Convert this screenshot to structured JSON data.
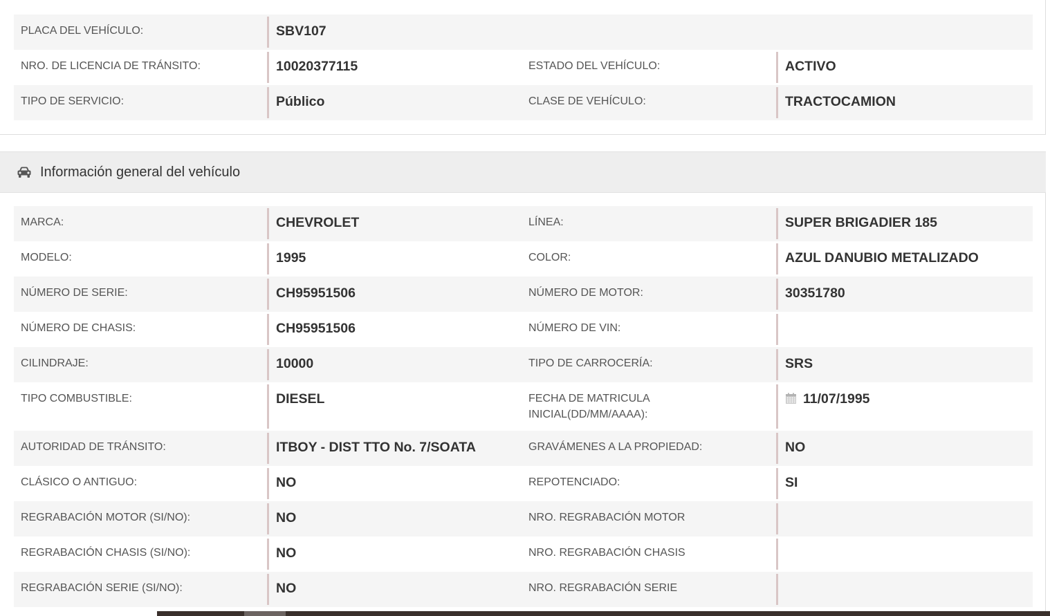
{
  "summary": {
    "rows": [
      {
        "l1": "PLACA DEL VEHÍCULO:",
        "v1": "SBV107",
        "l2": "",
        "v2": ""
      },
      {
        "l1": "NRO. DE LICENCIA DE TRÁNSITO:",
        "v1": "10020377115",
        "l2": "ESTADO DEL VEHÍCULO:",
        "v2": "ACTIVO"
      },
      {
        "l1": "TIPO DE SERVICIO:",
        "v1": "Público",
        "l2": "CLASE DE VEHÍCULO:",
        "v2": "TRACTOCAMION"
      }
    ]
  },
  "section": {
    "title": "Información general del vehículo",
    "icon": "car-icon"
  },
  "details": {
    "rows": [
      {
        "l1": "MARCA:",
        "v1": "CHEVROLET",
        "l2": "LÍNEA:",
        "v2": "SUPER BRIGADIER 185"
      },
      {
        "l1": "MODELO:",
        "v1": "1995",
        "l2": "COLOR:",
        "v2": "AZUL DANUBIO METALIZADO"
      },
      {
        "l1": "NÚMERO DE SERIE:",
        "v1": "CH95951506",
        "l2": "NÚMERO DE MOTOR:",
        "v2": "30351780"
      },
      {
        "l1": "NÚMERO DE CHASIS:",
        "v1": "CH95951506",
        "l2": "NÚMERO DE VIN:",
        "v2": ""
      },
      {
        "l1": "CILINDRAJE:",
        "v1": "10000",
        "l2": "TIPO DE CARROCERÍA:",
        "v2": "SRS"
      },
      {
        "l1": "TIPO COMBUSTIBLE:",
        "v1": "DIESEL",
        "l2a": "FECHA DE MATRICULA",
        "l2b": "INICIAL(DD/MM/AAAA):",
        "v2": "11/07/1995"
      },
      {
        "l1": "AUTORIDAD DE TRÁNSITO:",
        "v1": "ITBOY - DIST TTO No. 7/SOATA",
        "l2": "GRAVÁMENES A LA PROPIEDAD:",
        "v2": "NO"
      },
      {
        "l1": "CLÁSICO O ANTIGUO:",
        "v1": "NO",
        "l2": "REPOTENCIADO:",
        "v2": "SI"
      },
      {
        "l1": "REGRABACIÓN MOTOR (SI/NO):",
        "v1": "NO",
        "l2": "NRO. REGRABACIÓN MOTOR",
        "v2": ""
      },
      {
        "l1": "REGRABACIÓN CHASIS (SI/NO):",
        "v1": "NO",
        "l2": "NRO. REGRABACIÓN CHASIS",
        "v2": ""
      },
      {
        "l1": "REGRABACIÓN SERIE (SI/NO):",
        "v1": "NO",
        "l2": "NRO. REGRABACIÓN SERIE",
        "v2": ""
      }
    ]
  },
  "colors": {
    "row_alt": "#f5f5f5",
    "header_bg": "#eeeeee",
    "value_bar": "#d9c6c6",
    "text_value": "#333333",
    "text_label": "#555555"
  }
}
